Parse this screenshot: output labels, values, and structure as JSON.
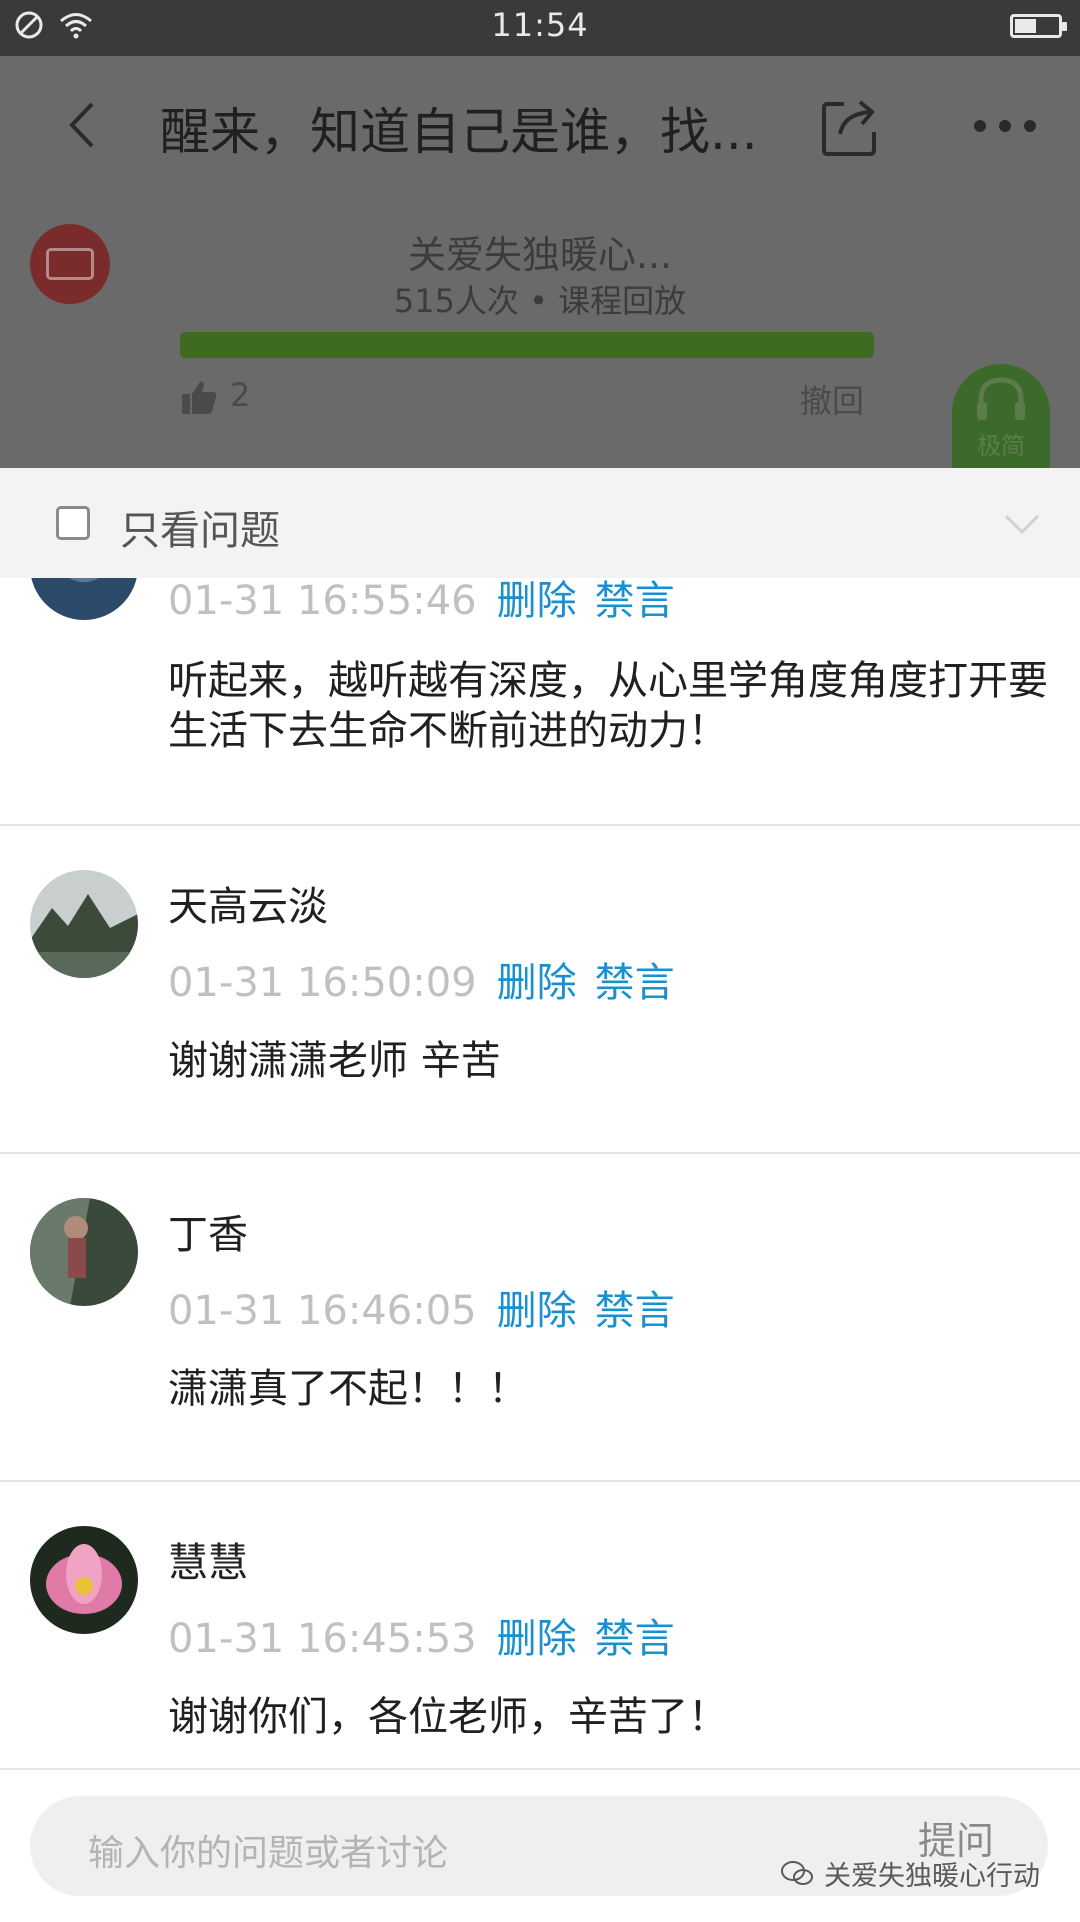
{
  "status_bar": {
    "time": "11:54",
    "battery_level": 0.5
  },
  "header": {
    "title": "醒来，知道自己是谁，找...",
    "course": {
      "name": "关爱失独暖心...",
      "stats": "515人次 • 课程回放",
      "progress": 1.0,
      "like_count": "2",
      "withdraw_label": "撤回",
      "listen_label": "极简"
    }
  },
  "filter": {
    "label": "只看问题",
    "checked": false
  },
  "actions": {
    "delete": "删除",
    "mute": "禁言"
  },
  "messages": [
    {
      "name": "",
      "time": "01-31 16:55:46",
      "content": "听起来，越听越有深度，从心里学角度角度打开要生活下去生命不断前进的动力！"
    },
    {
      "name": "天高云淡",
      "time": "01-31 16:50:09",
      "content": "谢谢潇潇老师 辛苦"
    },
    {
      "name": "丁香",
      "time": "01-31 16:46:05",
      "content": "潇潇真了不起！！！"
    },
    {
      "name": "慧慧",
      "time": "01-31 16:45:53",
      "content": "谢谢你们，各位老师，辛苦了！"
    }
  ],
  "input": {
    "placeholder": "输入你的问题或者讨论",
    "ask_label": "提问"
  },
  "watermark": "关爱失独暖心行动",
  "colors": {
    "link": "#1a90d0",
    "timestamp": "#c0c0c0",
    "progress": "#3e6a22",
    "overlay": "#6a6a6a"
  }
}
